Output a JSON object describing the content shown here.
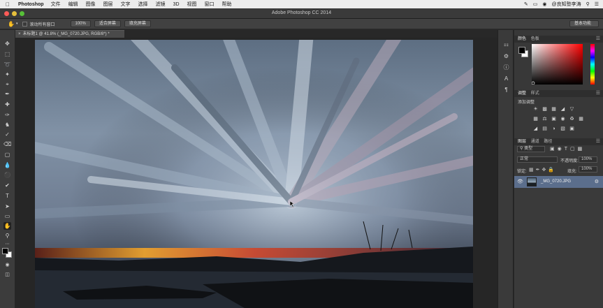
{
  "menubar": {
    "app_name": "Photoshop",
    "items": [
      "文件",
      "编辑",
      "图像",
      "图层",
      "文字",
      "选择",
      "滤镜",
      "3D",
      "视图",
      "窗口",
      "帮助"
    ],
    "user": "@良知塾李涛"
  },
  "window": {
    "title": "Adobe Photoshop CC 2014"
  },
  "options_bar": {
    "scroll_all_windows": "滚动所有窗口",
    "zoom_value": "100%",
    "fit_screen": "适合屏幕",
    "fill_screen": "填充屏幕",
    "workspace": "基本功能"
  },
  "document": {
    "tab_title": "未标题1 @ 41.8% (_MG_0720.JPG, RGB/8*) *"
  },
  "panels": {
    "color_tab": "颜色",
    "swatches_tab": "色板",
    "adjustments_tab": "调整",
    "styles_tab": "样式",
    "add_adjustment": "添加调整",
    "layers_tab": "图层",
    "channels_tab": "通道",
    "paths_tab": "路径",
    "filter_kind": "类型",
    "blend_mode": "正常",
    "opacity_label": "不透明度:",
    "opacity_value": "100%",
    "lock_label": "锁定:",
    "fill_label": "填充:",
    "fill_value": "100%",
    "layer_name": "_MG_0720.JPG"
  },
  "colors": {
    "ui_dark": "#3c3c3c",
    "selected_layer": "#5b6e8c",
    "foreground": "#000000",
    "background": "#ffffff",
    "picker_hue": "#ff0000"
  }
}
